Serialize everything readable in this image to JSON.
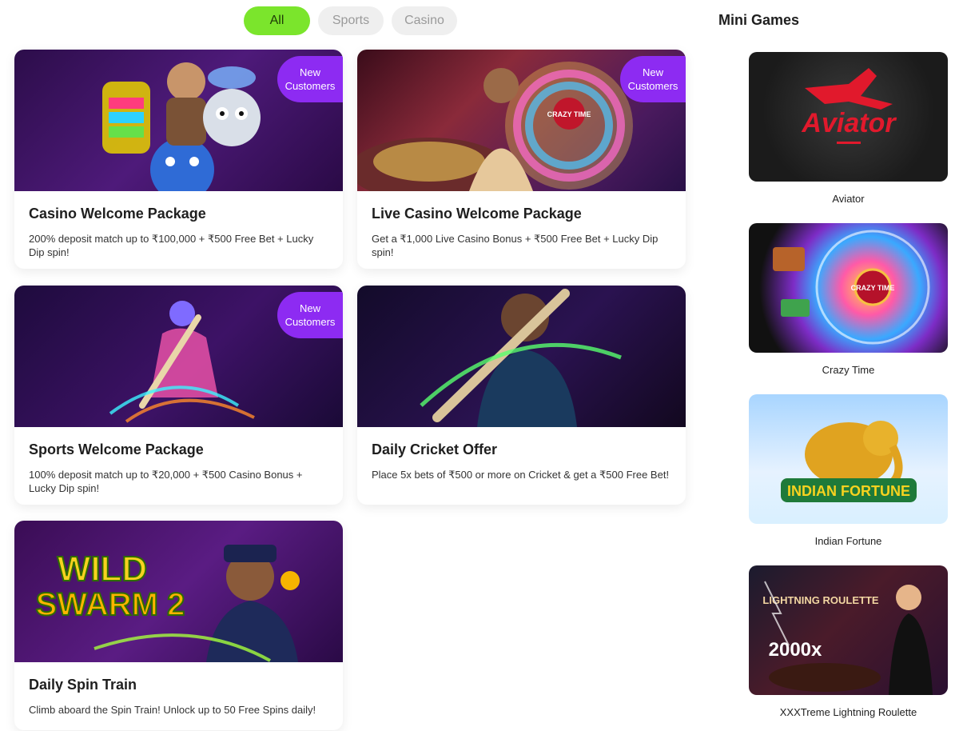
{
  "filters": {
    "all": "All",
    "sports": "Sports",
    "casino": "Casino"
  },
  "promos": [
    {
      "title": "Casino Welcome Package",
      "desc": "200% deposit match up to ₹100,000 + ₹500 Free Bet + Lucky Dip spin!",
      "badge_line1": "New",
      "badge_line2": "Customers"
    },
    {
      "title": "Live Casino Welcome Package",
      "desc": "Get a ₹1,000 Live Casino Bonus + ₹500 Free Bet + Lucky Dip spin!",
      "badge_line1": "New",
      "badge_line2": "Customers"
    },
    {
      "title": "Sports Welcome Package",
      "desc": "100% deposit match up to ₹20,000 + ₹500 Casino Bonus + Lucky Dip spin!",
      "badge_line1": "New",
      "badge_line2": "Customers"
    },
    {
      "title": "Daily Cricket Offer",
      "desc": "Place 5x bets of ₹500 or more on Cricket & get a ₹500 Free Bet!"
    },
    {
      "title": "Daily Spin Train",
      "desc": "Climb aboard the Spin Train! Unlock up to 50 Free Spins daily!"
    }
  ],
  "mini_games": {
    "title": "Mini Games",
    "items": [
      {
        "label": "Aviator",
        "art": "Aviator"
      },
      {
        "label": "Crazy Time",
        "art": "CRAZY TIME"
      },
      {
        "label": "Indian Fortune",
        "art": "INDIAN FORTUNE"
      },
      {
        "label": "XXXTreme Lightning Roulette",
        "art": "LIGHTNING ROULETTE",
        "art2": "2000x"
      }
    ]
  },
  "banner_art": {
    "spin_train_logo1": "WILD",
    "spin_train_logo2": "SWARM 2",
    "crazy_time": "CRAZY TIME"
  },
  "colors": {
    "accent": "#7be52c",
    "badge": "#8d2bf2"
  }
}
